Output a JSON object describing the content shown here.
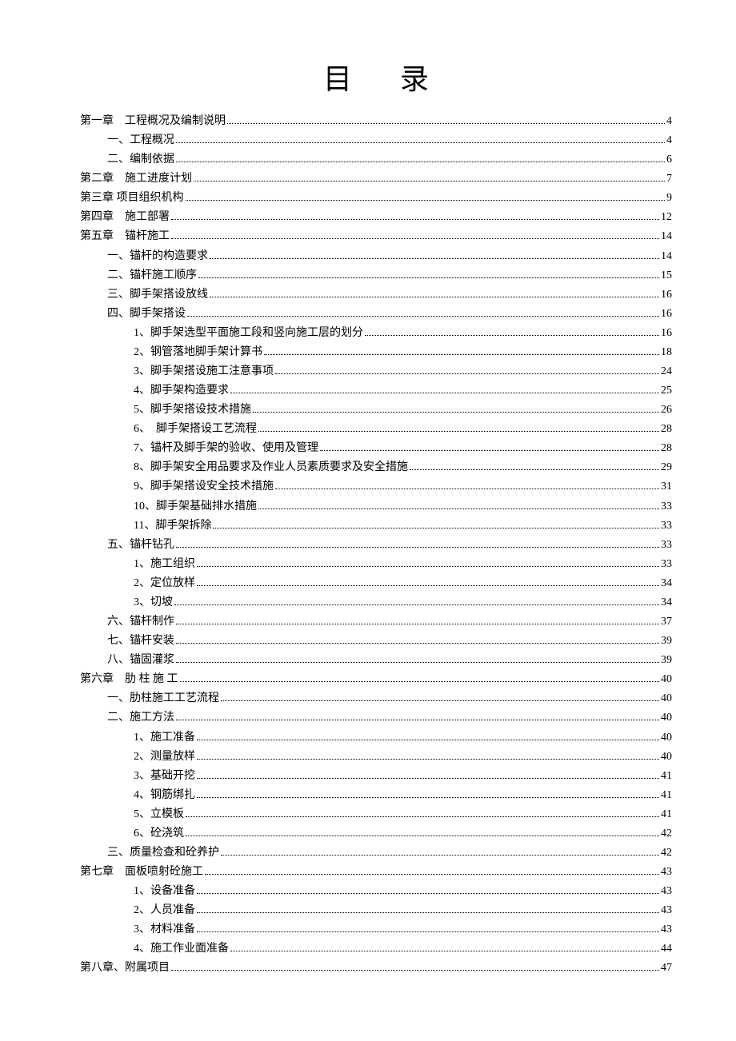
{
  "title": "目录",
  "toc": [
    {
      "level": 0,
      "label": "第一章　工程概况及编制说明",
      "page": "4"
    },
    {
      "level": 1,
      "label": "一、工程概况",
      "page": "4"
    },
    {
      "level": 1,
      "label": "二、编制依据",
      "page": "6"
    },
    {
      "level": 0,
      "label": "第二章　施工进度计划",
      "page": "7"
    },
    {
      "level": 0,
      "label": "第三章  项目组织机构",
      "page": "9"
    },
    {
      "level": 0,
      "label": "第四章　施工部署",
      "page": "12"
    },
    {
      "level": 0,
      "label": "第五章　锚杆施工",
      "page": "14"
    },
    {
      "level": 1,
      "label": "一、锚杆的构造要求",
      "page": "14"
    },
    {
      "level": 1,
      "label": "二、锚杆施工顺序",
      "page": "15"
    },
    {
      "level": 1,
      "label": "三、脚手架搭设放线",
      "page": "16"
    },
    {
      "level": 1,
      "label": "四、脚手架搭设",
      "page": "16"
    },
    {
      "level": 2,
      "label": "1、脚手架选型平面施工段和竖向施工层的划分",
      "page": "16"
    },
    {
      "level": 2,
      "label": "2、钢管落地脚手架计算书",
      "page": "18"
    },
    {
      "level": 2,
      "label": "3、脚手架搭设施工注意事项",
      "page": "24"
    },
    {
      "level": 2,
      "label": "4、脚手架构造要求",
      "page": "25"
    },
    {
      "level": 2,
      "label": "5、脚手架搭设技术措施",
      "page": "26"
    },
    {
      "level": 2,
      "label": "6、　脚手架搭设工艺流程",
      "page": "28"
    },
    {
      "level": 2,
      "label": "7、锚杆及脚手架的验收、使用及管理",
      "page": "28"
    },
    {
      "level": 2,
      "label": "8、脚手架安全用品要求及作业人员素质要求及安全措施",
      "page": "29"
    },
    {
      "level": 2,
      "label": "9、脚手架搭设安全技术措施",
      "page": "31"
    },
    {
      "level": 2,
      "label": "10、脚手架基础排水措施",
      "page": "33"
    },
    {
      "level": 2,
      "label": "11、脚手架拆除",
      "page": "33"
    },
    {
      "level": 1,
      "label": "五、锚杆钻孔",
      "page": "33"
    },
    {
      "level": 2,
      "label": "1、施工组织",
      "page": "33"
    },
    {
      "level": 2,
      "label": "2、定位放样",
      "page": "34"
    },
    {
      "level": 2,
      "label": "3、切坡",
      "page": "34"
    },
    {
      "level": 1,
      "label": "六、锚杆制作",
      "page": "37"
    },
    {
      "level": 1,
      "label": "七、锚杆安装",
      "page": "39"
    },
    {
      "level": 1,
      "label": "八、锚固灌浆",
      "page": "39"
    },
    {
      "level": 0,
      "label": "第六章　肋 柱 施 工",
      "page": "40"
    },
    {
      "level": 1,
      "label": "一、肋柱施工工艺流程",
      "page": "40"
    },
    {
      "level": 1,
      "label": "二、施工方法",
      "page": "40"
    },
    {
      "level": 2,
      "label": "1、施工准备",
      "page": "40"
    },
    {
      "level": 2,
      "label": "2、测量放样",
      "page": "40"
    },
    {
      "level": 2,
      "label": "3、基础开挖",
      "page": "41"
    },
    {
      "level": 2,
      "label": "4、钢筋绑扎",
      "page": "41"
    },
    {
      "level": 2,
      "label": "5、立模板",
      "page": "41"
    },
    {
      "level": 2,
      "label": "6、砼浇筑",
      "page": "42"
    },
    {
      "level": 1,
      "label": "三、质量检查和砼养护",
      "page": "42"
    },
    {
      "level": 0,
      "label": "第七章　面板喷射砼施工",
      "page": "43"
    },
    {
      "level": 2,
      "label": "1、设备准备",
      "page": "43"
    },
    {
      "level": 2,
      "label": "2、人员准备",
      "page": "43"
    },
    {
      "level": 2,
      "label": "3、材料准备",
      "page": "43"
    },
    {
      "level": 2,
      "label": "4、施工作业面准备",
      "page": "44"
    },
    {
      "level": 0,
      "label": "第八章、附属项目",
      "page": "47"
    }
  ]
}
